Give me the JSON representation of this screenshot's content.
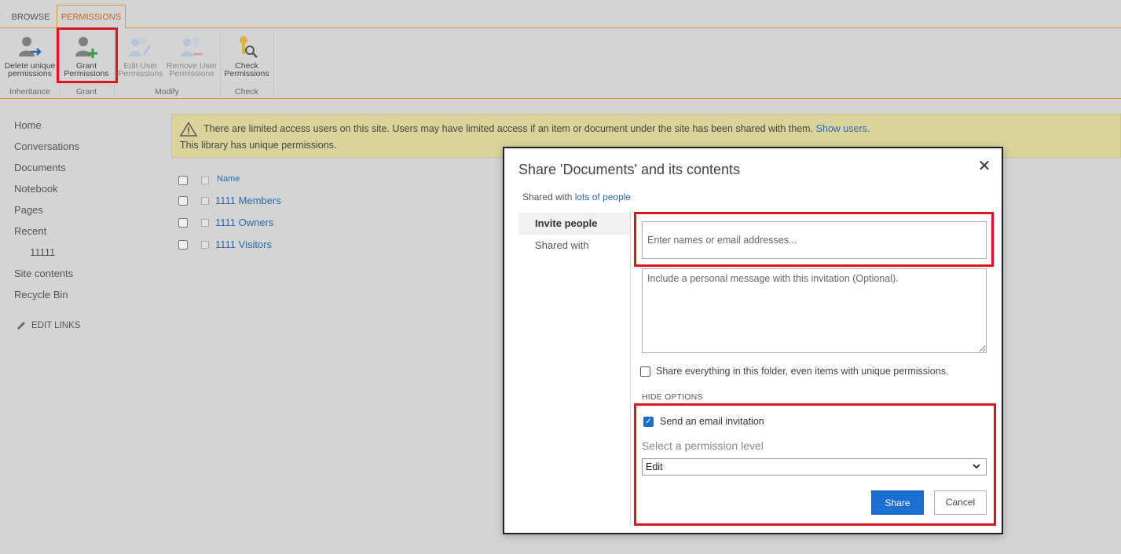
{
  "ribbon": {
    "tabs": [
      {
        "label": "BROWSE"
      },
      {
        "label": "PERMISSIONS"
      }
    ],
    "buttons": {
      "delete_unique": {
        "line1": "Delete unique",
        "line2": "permissions"
      },
      "grant": {
        "line1": "Grant",
        "line2": "Permissions"
      },
      "edit_user": {
        "line1": "Edit User",
        "line2": "Permissions"
      },
      "remove_user": {
        "line1": "Remove User",
        "line2": "Permissions"
      },
      "check": {
        "line1": "Check",
        "line2": "Permissions"
      }
    },
    "groups": {
      "inheritance": "Inheritance",
      "grant": "Grant",
      "modify": "Modify",
      "check": "Check"
    }
  },
  "leftnav": {
    "items": [
      {
        "label": "Home"
      },
      {
        "label": "Conversations"
      },
      {
        "label": "Documents"
      },
      {
        "label": "Notebook"
      },
      {
        "label": "Pages"
      },
      {
        "label": "Recent"
      },
      {
        "label": "11111"
      },
      {
        "label": "Site contents"
      },
      {
        "label": "Recycle Bin"
      }
    ],
    "edit_links": "EDIT LINKS"
  },
  "banner": {
    "line1": "There are limited access users on this site. Users may have limited access if an item or document under the site has been shared with them.",
    "show_users": "Show users.",
    "line2": "This library has unique permissions."
  },
  "list": {
    "header_name": "Name",
    "groups": [
      {
        "name": "1111 Members"
      },
      {
        "name": "1111 Owners"
      },
      {
        "name": "1111 Visitors"
      }
    ]
  },
  "dialog": {
    "title": "Share 'Documents' and its contents",
    "shared_with_prefix": "Shared with",
    "shared_with_link": "lots of people",
    "tabs": [
      {
        "label": "Invite people"
      },
      {
        "label": "Shared with"
      }
    ],
    "names_placeholder": "Enter names or email addresses...",
    "message_placeholder": "Include a personal message with this invitation (Optional).",
    "share_everything_label": "Share everything in this folder, even items with unique permissions.",
    "hide_options": "HIDE OPTIONS",
    "send_email_label": "Send an email invitation",
    "permission_level_label": "Select a permission level",
    "permission_level_value": "Edit",
    "share_button": "Share",
    "cancel_button": "Cancel"
  },
  "colors": {
    "accent_orange": "#d99a2b",
    "highlight_red": "#e0141e",
    "primary_blue": "#1a6fd0",
    "link_blue": "#2a6aa8",
    "banner_yellow": "#dad49a"
  }
}
